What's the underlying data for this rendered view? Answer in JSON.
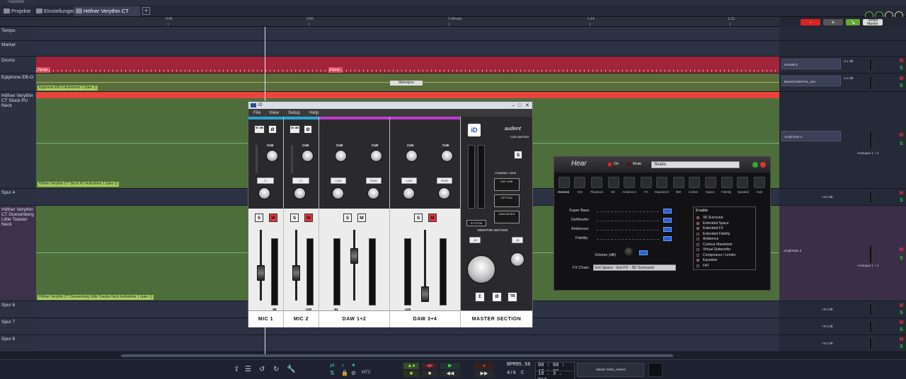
{
  "window": {
    "title": "Tracktion"
  },
  "tabs": [
    {
      "label": "Projekte"
    },
    {
      "label": "Einstellungen"
    },
    {
      "label": "Höfner Verythin CT Pic..."
    }
  ],
  "ruler": {
    "labels": [
      "0:46",
      "0:55",
      "1 Minute",
      "1:14",
      "1:23"
    ]
  },
  "top_controls": {
    "minus": "-",
    "plus": "+",
    "tempo": "Tempo",
    "marker": "Marker"
  },
  "tracks": [
    {
      "name": "Tempo"
    },
    {
      "name": "Marker"
    },
    {
      "name": "Drums",
      "clip": "Drums",
      "clip2": "Drums",
      "plugin": "Kontakt 5",
      "db": "-3.1 dB"
    },
    {
      "name": "Epiphone EB-O",
      "clip": "Epiphone EB-O Aufnahme 1 (take 1)",
      "clip_mid": "Melodyne",
      "plugin": "BassGrinderFree_x64",
      "db": "-2.2 dB"
    },
    {
      "name": "Höfner Verythin CT Stock PU Neck",
      "clip": "Höfner Verythin CT Stock PU Aufnahme 1 (take 1)",
      "plugin": "AmpliTube 4",
      "route": "Analogue 1 + 2"
    },
    {
      "name": "Spur 4",
      "db": "+0.0 dB"
    },
    {
      "name": "Höfner Verythin CT Duesenberg Little Toaster Neck",
      "clip": "Höfner Verythin CT Duesenberg Little Toaster Neck Aufnahme 1 (take 1)",
      "plugin": "AmpliTube 4",
      "route": "Analogue 1 + 2"
    },
    {
      "name": "Spur 6",
      "db": "+0.0 dB"
    },
    {
      "name": "Spur 7",
      "db": "+0.0 dB"
    },
    {
      "name": "Spur 8",
      "db": "+0.0 dB"
    }
  ],
  "mute_label": "M",
  "solo_label": "S",
  "transport": {
    "bpm": "BPM95.56",
    "time": "00 : 00 : 47 : 00",
    "sig": "4/4",
    "key": "C",
    "bars": "19 . 3 . 817",
    "mtc": "MTC",
    "master": "Master Mix",
    "fx": "fx_meters"
  },
  "id_app": {
    "title": "iD",
    "menu": [
      "File",
      "View",
      "Setup",
      "Help"
    ],
    "channels": [
      {
        "name": "MIC 1",
        "pad": "50 dB",
        "phase": "Ø",
        "cue": "CUE",
        "pan": "- C -",
        "color": "#29a3d6"
      },
      {
        "name": "MIC 2",
        "pad": "50 dB",
        "phase": "Ø",
        "cue": "CUE",
        "pan": "- C -",
        "color": "#29a3d6"
      },
      {
        "name": "DAW 1+2",
        "cue": "CUE",
        "panL": "L100",
        "panR": "R100",
        "color": "#c03ad0"
      },
      {
        "name": "DAW 3+4",
        "cue": "CUE",
        "panL": "L100",
        "panR": "R100",
        "color": "#c03ad0"
      }
    ],
    "master": {
      "name": "MASTER SECTION",
      "logo": "iD",
      "brand": "audient",
      "cue_master": "CUE MASTER",
      "channel_view": "CHANNEL VIEW",
      "mic_line": "MIC LINE",
      "optical": "OPTICAL",
      "daw_mixes": "DAW MIXES",
      "system": "SYSTEM",
      "monitor": "MONITOR SECTION",
      "mon_left": "-29",
      "mon_right": "-31",
      "sum": "Σ",
      "phase": "Ø",
      "tb": "TB"
    },
    "solo": "S",
    "mute": "M",
    "fader_readout": [
      "-88",
      "-128",
      "-84",
      "-128"
    ]
  },
  "hear_app": {
    "title": "Hear",
    "on": "On",
    "mute": "Mute",
    "preset": "Studio",
    "tabs": [
      "General",
      "EQ",
      "Playback",
      "3D",
      "Ambience",
      "FX",
      "Maximizer",
      "BW",
      "Limiter",
      "Space",
      "Fidelity",
      "Speaker",
      "Sub"
    ],
    "sliders": [
      "Super Bass",
      "DeWoofer",
      "Ambience",
      "Fidelity"
    ],
    "volume_label": "Volume (dB)",
    "fxchain_label": "FX Chain",
    "fxchain_value": "Ext.Space - Ext.FX - 3D Surround",
    "enable_title": "Enable",
    "enable_items": [
      {
        "label": "3D Surround",
        "on": true
      },
      {
        "label": "Extended Space",
        "on": true
      },
      {
        "label": "Extended FX",
        "on": true
      },
      {
        "label": "Extended Fidelity",
        "on": false
      },
      {
        "label": "Ambience",
        "on": false
      },
      {
        "label": "Contour Maximizer",
        "on": false
      },
      {
        "label": "Virtual Subwoofer",
        "on": false
      },
      {
        "label": "Compressor / Limiter",
        "on": false
      },
      {
        "label": "Equalizer",
        "on": true
      },
      {
        "label": "FAT",
        "on": false
      }
    ]
  }
}
